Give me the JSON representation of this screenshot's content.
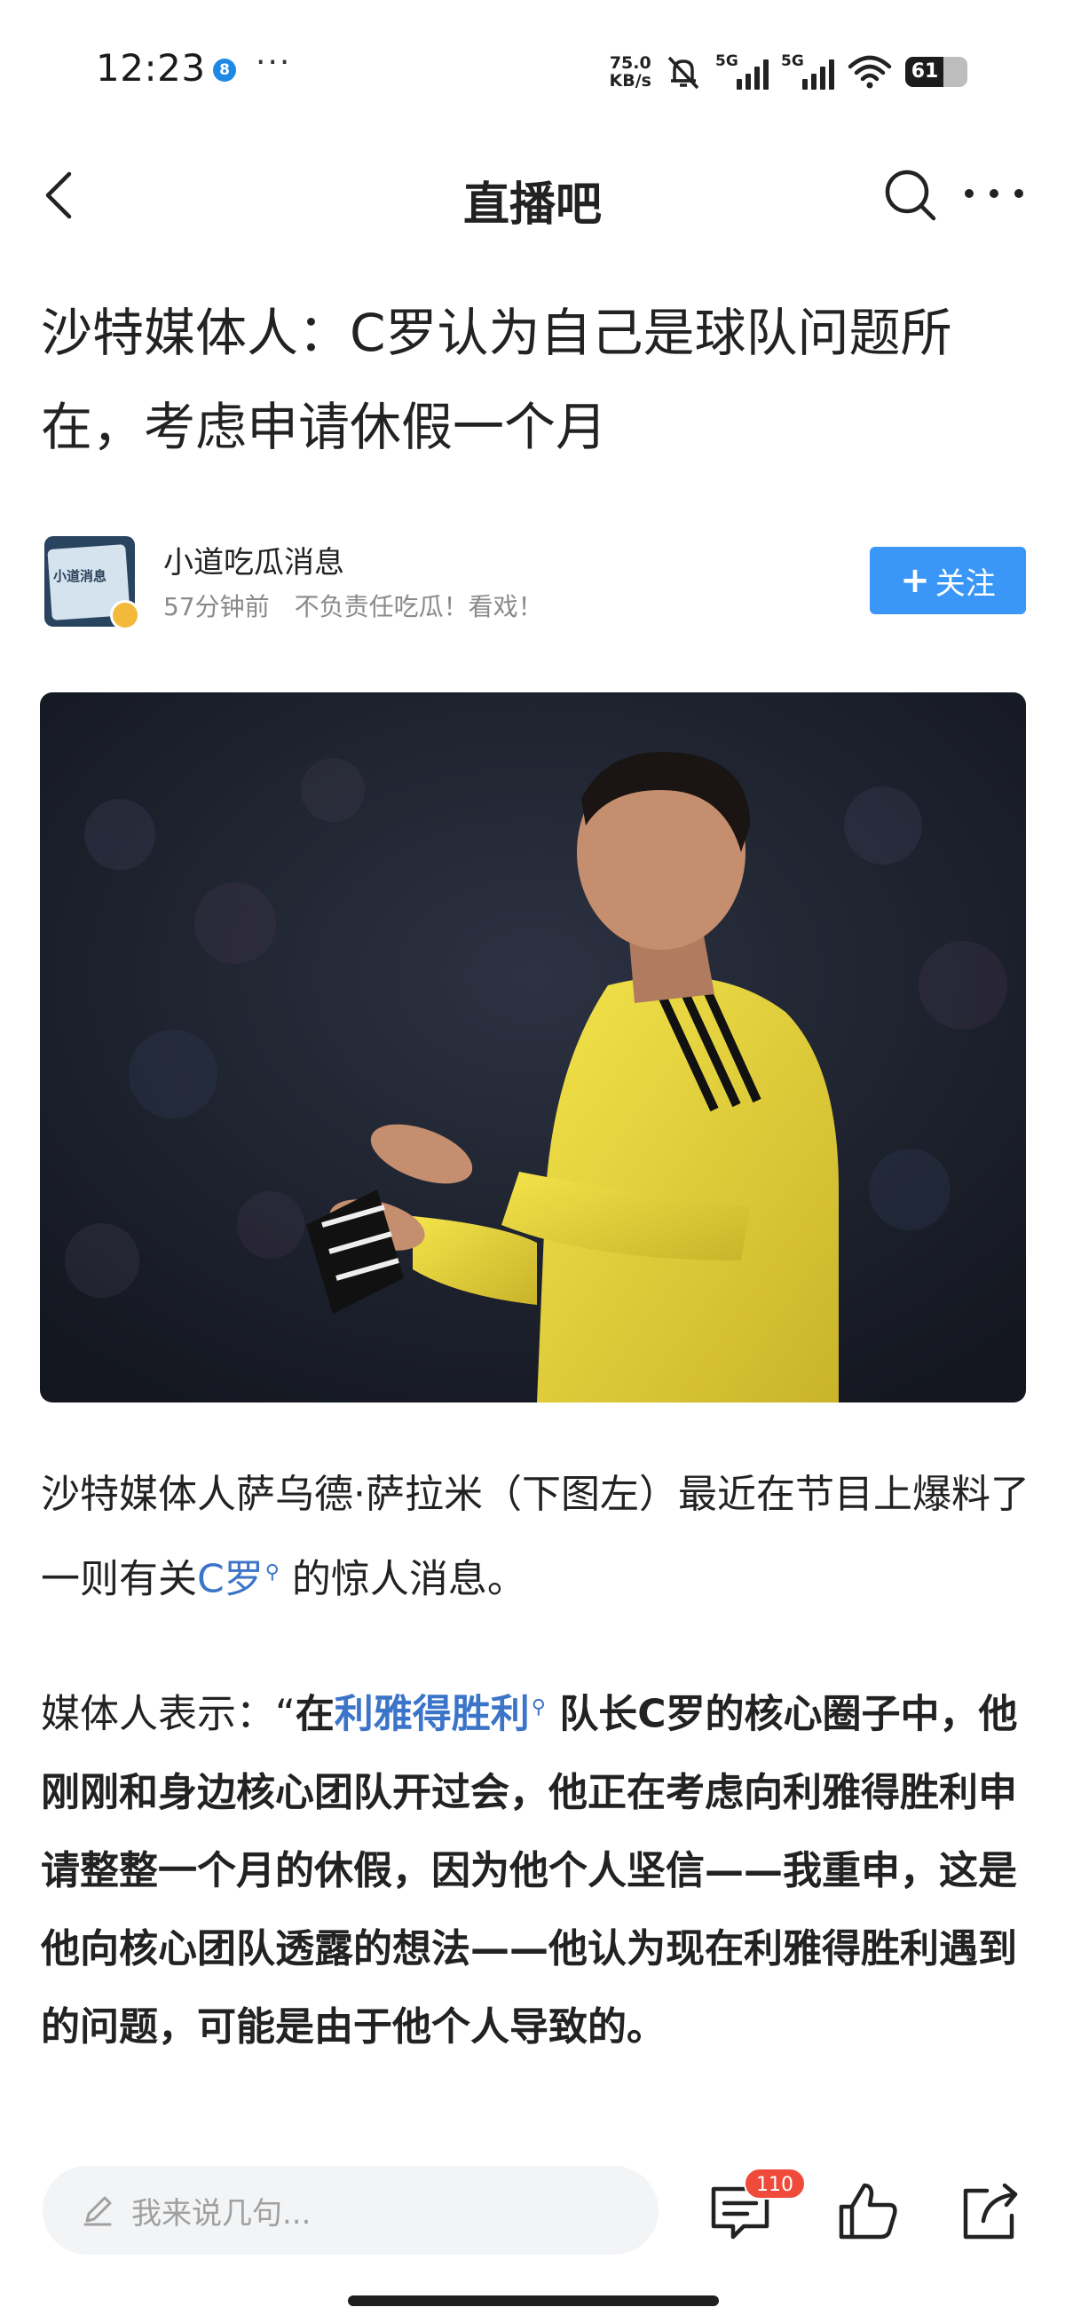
{
  "status": {
    "time": "12:23",
    "app_dot": "8",
    "more": "···",
    "speed_value": "75.0",
    "speed_unit": "KB/s",
    "network_1": "5G",
    "network_2": "5G",
    "battery": "61",
    "battery_level": 0.61
  },
  "nav": {
    "title": "直播吧"
  },
  "article": {
    "title": "沙特媒体人：C罗认为自己是球队问题所在，考虑申请休假一个月",
    "author": {
      "name": "小道吃瓜消息",
      "avatar_text": "小道消息",
      "time": "57分钟前",
      "signature": "不负责任吃瓜！看戏！"
    },
    "follow_label": "关注",
    "para1": {
      "t1": "沙特媒体人萨乌德·萨拉米（下图左）最近在节目上爆料了一则有关",
      "link": "C罗",
      "t2": " 的惊人消息。"
    },
    "para2": {
      "lead": "媒体人表示：“",
      "t1": "在",
      "link": "利雅得胜利",
      "t2": " 队长C罗的核心圈子中，他刚刚和身边核心团队开过会，他正在考虑向利雅得胜利申请整整一个月的休假，因为他个人坚信——我重申，这是他向核心团队透露的想法——他认为现在利雅得胜利遇到的问题，可能是由于他个人导致的。"
    }
  },
  "bottom": {
    "comment_placeholder": "我来说几句...",
    "comment_count": "110"
  },
  "colors": {
    "accent": "#3b97f7",
    "link": "#3b74c8",
    "badge": "#f04a3b"
  }
}
